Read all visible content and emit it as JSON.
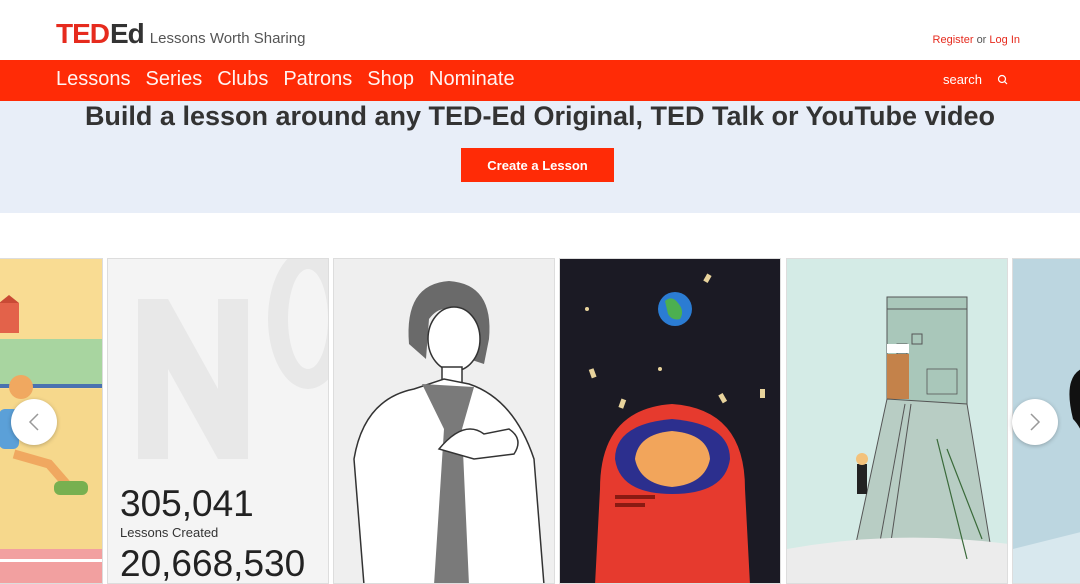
{
  "header": {
    "logo_ted": "TED",
    "logo_ed": "Ed",
    "tagline": "Lessons Worth Sharing",
    "register": "Register",
    "or": "or",
    "login": "Log In"
  },
  "nav": {
    "items": [
      "Lessons",
      "Series",
      "Clubs",
      "Patrons",
      "Shop",
      "Nominate"
    ],
    "search_label": "search"
  },
  "banner": {
    "title": "Build a lesson around any TED-Ed Original, TED Talk or YouTube video",
    "button": "Create a Lesson"
  },
  "stats": {
    "lessons_count": "305,041",
    "lessons_label": "Lessons Created",
    "second_count": "20,668,530"
  },
  "carousel": {
    "prev_icon": "chevron-left-icon",
    "next_icon": "chevron-right-icon"
  },
  "colors": {
    "brand_red": "#ff2b06",
    "banner_bg": "#e8eef8"
  }
}
